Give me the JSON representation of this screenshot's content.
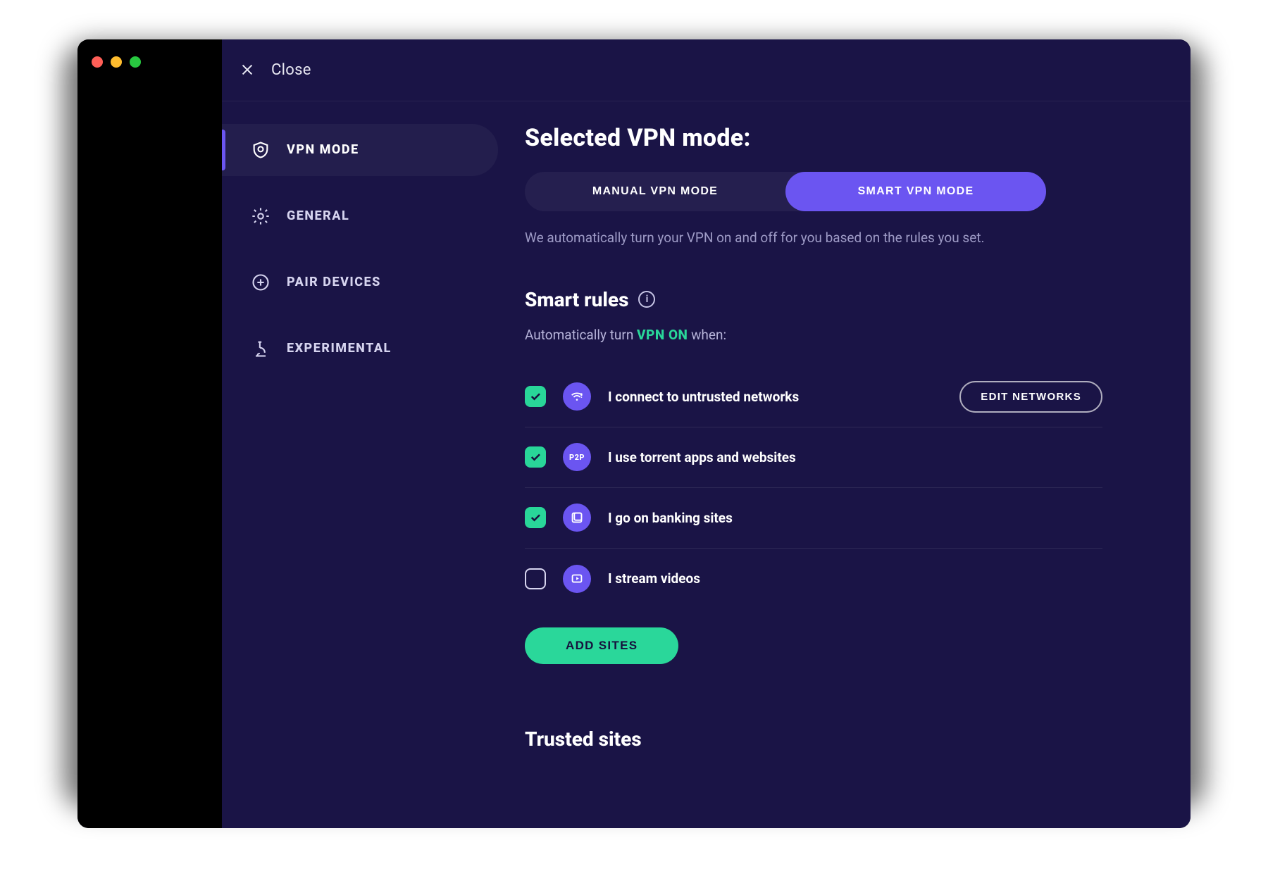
{
  "header": {
    "close_label": "Close"
  },
  "sidebar": {
    "items": [
      {
        "id": "vpn-mode",
        "label": "VPN MODE",
        "active": true
      },
      {
        "id": "general",
        "label": "GENERAL",
        "active": false
      },
      {
        "id": "pair-devices",
        "label": "PAIR DEVICES",
        "active": false
      },
      {
        "id": "experimental",
        "label": "EXPERIMENTAL",
        "active": false
      }
    ]
  },
  "main": {
    "title": "Selected VPN mode:",
    "segmented": {
      "options": [
        {
          "id": "manual",
          "label": "MANUAL VPN MODE",
          "active": false
        },
        {
          "id": "smart",
          "label": "SMART VPN MODE",
          "active": true
        }
      ]
    },
    "description": "We automatically turn your VPN on and off for you based on the rules you set.",
    "smart_rules": {
      "heading": "Smart rules",
      "auto_prefix": "Automatically turn ",
      "auto_highlight": "VPN ON",
      "auto_suffix": " when:",
      "rules": [
        {
          "id": "networks",
          "label": "I connect to untrusted networks",
          "checked": true,
          "icon": "wifi",
          "action_label": "EDIT NETWORKS"
        },
        {
          "id": "torrent",
          "label": "I use torrent apps and websites",
          "checked": true,
          "icon": "p2p",
          "action_label": null
        },
        {
          "id": "banking",
          "label": "I go on banking sites",
          "checked": true,
          "icon": "bank",
          "action_label": null
        },
        {
          "id": "stream",
          "label": "I stream videos",
          "checked": false,
          "icon": "stream",
          "action_label": null
        }
      ],
      "add_button": "ADD SITES"
    },
    "trusted_sites_heading": "Trusted sites"
  }
}
